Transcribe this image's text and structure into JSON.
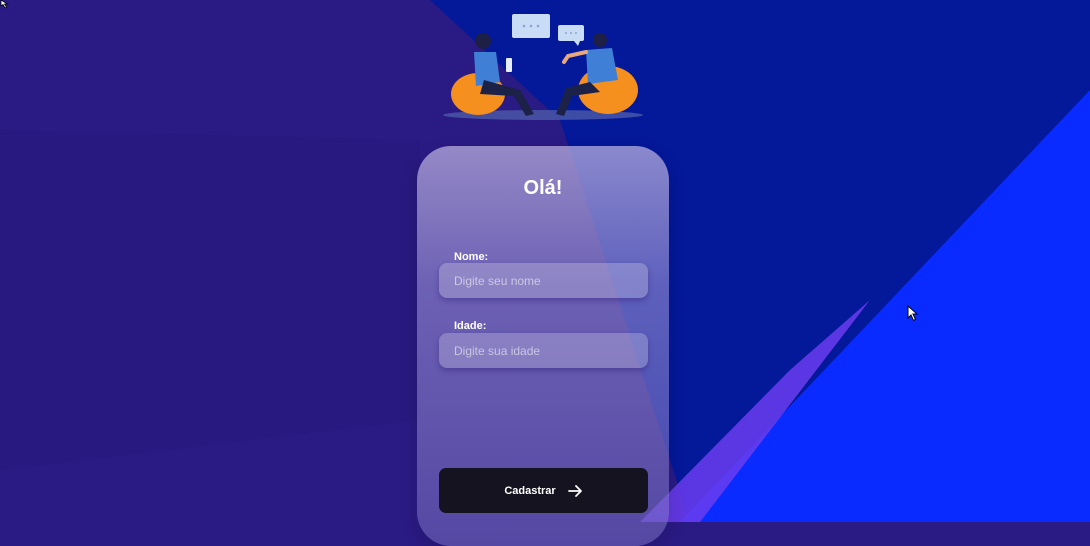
{
  "colors": {
    "background_left": "#2a1a84",
    "background_right": "#021898",
    "background_blue": "#0a2bff",
    "background_purple": "#6a3df0",
    "button": "#15131f",
    "text": "#ffffff",
    "seat": "#f5901e",
    "speech_bubble": "#c9dcf5"
  },
  "illustration": {
    "icon": "two-people-chatting-illustration"
  },
  "form": {
    "title": "Olá!",
    "name_label": "Nome:",
    "name_placeholder": "Digite seu nome",
    "name_value": "",
    "age_label": "Idade:",
    "age_placeholder": "Digite sua idade",
    "age_value": "",
    "submit_label": "Cadastrar",
    "submit_icon": "arrow-right-icon"
  }
}
